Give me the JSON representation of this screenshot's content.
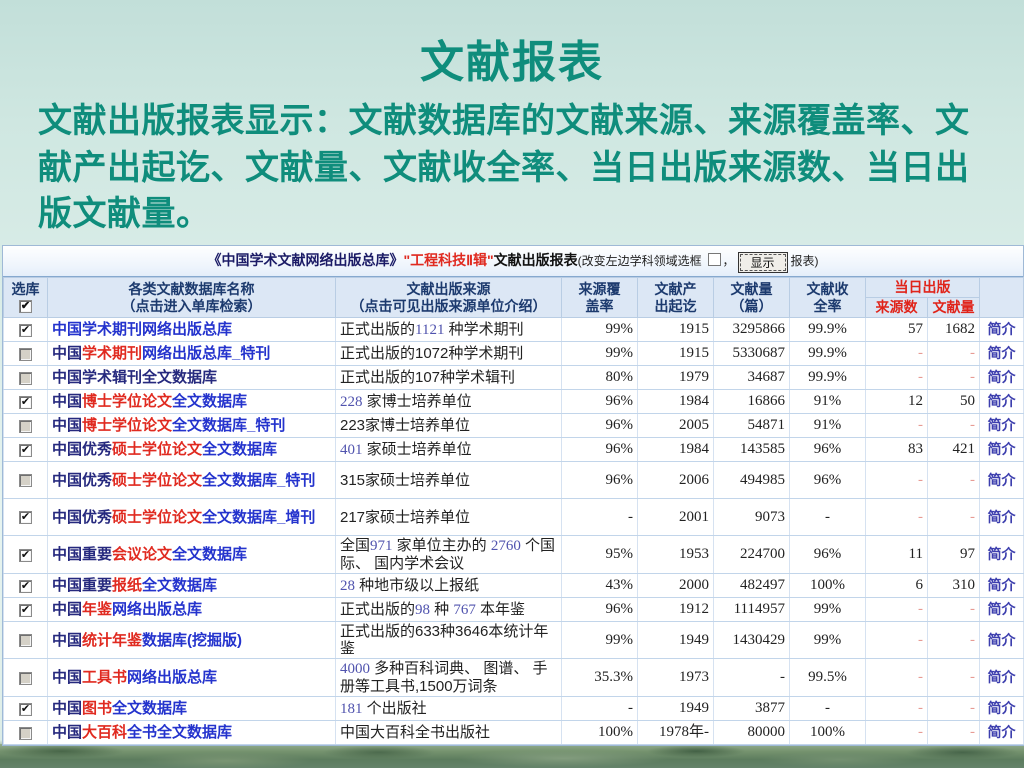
{
  "slide": {
    "title": "文献报表",
    "body": "文献出版报表显示：文献数据库的文献来源、来源覆盖率、文献产出起讫、文献量、文献收全率、当日出版来源数、当日出版文献量。"
  },
  "icons": {
    "check_glyph": "✔"
  },
  "colors": {
    "accent_teal": "#0f8d7c",
    "link_blue": "#2433cd",
    "link_navy": "#26297e",
    "highlight_red": "#e02a20",
    "number_blue": "#5053ae",
    "today_red": "#e0392b",
    "today_dash_red": "#e79b94",
    "intro_link_blue": "#3d3fae",
    "text_black": "#222222",
    "header_text_navy": "#1c3a6e",
    "header_bg": "#dce7f5"
  },
  "report": {
    "caption": {
      "library": "《中国学术文献网络出版总库》",
      "subject": "\"工程科技Ⅱ辑\"",
      "suffix": "文献出版报表",
      "note_prefix": "(改变左边学科领域选框",
      "note_comma": "，",
      "show_button": "显示",
      "note_suffix": "报表)"
    },
    "headers": {
      "select": "选库",
      "name_l1": "各类文献数据库名称",
      "name_l2": "（点击进入单库检索）",
      "source_l1": "文献出版来源",
      "source_l2": "（点击可见出版来源单位介绍）",
      "coverage_l1": "来源覆",
      "coverage_l2": "盖率",
      "span_l1": "文献产",
      "span_l2": "出起讫",
      "volume_l1": "文献量",
      "volume_l2": "（篇）",
      "complete_l1": "文献收",
      "complete_l2": "全率",
      "today": "当日出版",
      "today_source": "来源数",
      "today_volume": "文献量"
    },
    "intro_label": "简介",
    "rows": [
      {
        "checked": true,
        "name": [
          [
            "中国学术期刊网络出版总库",
            "blue"
          ]
        ],
        "source": [
          [
            "正式出版的",
            "black"
          ],
          [
            "1121",
            "num"
          ],
          [
            " 种学术期刊",
            "black"
          ]
        ],
        "coverage": "99%",
        "span": "1915",
        "volume": "3295866",
        "complete": "99.9%",
        "today_source": "57",
        "today_volume": "1682"
      },
      {
        "checked": false,
        "name": [
          [
            "中国",
            "navy"
          ],
          [
            "学术期刊",
            "red"
          ],
          [
            "网络出版总库_特刊",
            "blue"
          ]
        ],
        "source": [
          [
            "正式出版的1072种学术期刊",
            "black"
          ]
        ],
        "coverage": "99%",
        "span": "1915",
        "volume": "5330687",
        "complete": "99.9%",
        "today_source": "-",
        "today_volume": "-"
      },
      {
        "checked": false,
        "name": [
          [
            "中国学术辑刊全文数据库",
            "navy"
          ]
        ],
        "source": [
          [
            "正式出版的107种学术辑刊",
            "black"
          ]
        ],
        "coverage": "80%",
        "span": "1979",
        "volume": "34687",
        "complete": "99.9%",
        "today_source": "-",
        "today_volume": "-"
      },
      {
        "checked": true,
        "name": [
          [
            "中国",
            "navy"
          ],
          [
            "博士学位论文",
            "red"
          ],
          [
            "全文数据库",
            "blue"
          ]
        ],
        "source": [
          [
            "228",
            "num"
          ],
          [
            " 家博士培养单位",
            "black"
          ]
        ],
        "coverage": "96%",
        "span": "1984",
        "volume": "16866",
        "complete": "91%",
        "today_source": "12",
        "today_volume": "50"
      },
      {
        "checked": false,
        "name": [
          [
            "中国",
            "navy"
          ],
          [
            "博士学位论文",
            "red"
          ],
          [
            "全文数据库_特刊",
            "blue"
          ]
        ],
        "source": [
          [
            "223家博士培养单位",
            "black"
          ]
        ],
        "coverage": "96%",
        "span": "2005",
        "volume": "54871",
        "complete": "91%",
        "today_source": "-",
        "today_volume": "-"
      },
      {
        "checked": true,
        "name": [
          [
            "中国优秀",
            "navy"
          ],
          [
            "硕士学位论文",
            "red"
          ],
          [
            "全文数据库",
            "blue"
          ]
        ],
        "source": [
          [
            "401",
            "num"
          ],
          [
            " 家硕士培养单位",
            "black"
          ]
        ],
        "coverage": "96%",
        "span": "1984",
        "volume": "143585",
        "complete": "96%",
        "today_source": "83",
        "today_volume": "421"
      },
      {
        "checked": false,
        "name": [
          [
            "中国优秀",
            "navy"
          ],
          [
            "硕士学位论文",
            "red"
          ],
          [
            "全文数据库_特刊",
            "blue"
          ]
        ],
        "source": [
          [
            "315家硕士培养单位",
            "black"
          ]
        ],
        "coverage": "96%",
        "span": "2006",
        "volume": "494985",
        "complete": "96%",
        "today_source": "-",
        "today_volume": "-"
      },
      {
        "checked": true,
        "name": [
          [
            "中国优秀",
            "navy"
          ],
          [
            "硕士学位论文",
            "red"
          ],
          [
            "全文数据库_增刊",
            "blue"
          ]
        ],
        "source": [
          [
            "217家硕士培养单位",
            "black"
          ]
        ],
        "coverage": "-",
        "span": "2001",
        "volume": "9073",
        "complete": "-",
        "today_source": "-",
        "today_volume": "-"
      },
      {
        "checked": true,
        "name": [
          [
            "中国重要",
            "navy"
          ],
          [
            "会议论文",
            "red"
          ],
          [
            "全文数据库",
            "blue"
          ]
        ],
        "source": [
          [
            "全国",
            "black"
          ],
          [
            "971",
            "num"
          ],
          [
            " 家单位主办的 ",
            "black"
          ],
          [
            "2760",
            "num"
          ],
          [
            " 个国际、 国内学术会议",
            "black"
          ]
        ],
        "coverage": "95%",
        "span": "1953",
        "volume": "224700",
        "complete": "96%",
        "today_source": "11",
        "today_volume": "97"
      },
      {
        "checked": true,
        "name": [
          [
            "中国重要",
            "navy"
          ],
          [
            "报纸",
            "red"
          ],
          [
            "全文数据库",
            "blue"
          ]
        ],
        "source": [
          [
            "28",
            "num"
          ],
          [
            " 种地市级以上报纸",
            "black"
          ]
        ],
        "coverage": "43%",
        "span": "2000",
        "volume": "482497",
        "complete": "100%",
        "today_source": "6",
        "today_volume": "310"
      },
      {
        "checked": true,
        "name": [
          [
            "中国",
            "navy"
          ],
          [
            "年鉴",
            "red"
          ],
          [
            "网络出版总库",
            "blue"
          ]
        ],
        "source": [
          [
            "正式出版的",
            "black"
          ],
          [
            "98",
            "num"
          ],
          [
            " 种 ",
            "black"
          ],
          [
            "767",
            "num"
          ],
          [
            " 本年鉴",
            "black"
          ]
        ],
        "coverage": "96%",
        "span": "1912",
        "volume": "1114957",
        "complete": "99%",
        "today_source": "-",
        "today_volume": "-"
      },
      {
        "checked": false,
        "name": [
          [
            "中国",
            "navy"
          ],
          [
            "统计年鉴",
            "red"
          ],
          [
            "数据库(挖掘版)",
            "blue"
          ]
        ],
        "source": [
          [
            "正式出版的633种3646本统计年鉴",
            "black"
          ]
        ],
        "coverage": "99%",
        "span": "1949",
        "volume": "1430429",
        "complete": "99%",
        "today_source": "-",
        "today_volume": "-"
      },
      {
        "checked": false,
        "name": [
          [
            "中国",
            "navy"
          ],
          [
            "工具书",
            "red"
          ],
          [
            "网络出版总库",
            "blue"
          ]
        ],
        "source": [
          [
            "4000",
            "num"
          ],
          [
            " 多种百科词典、 图谱、 手册等工具书,1500万词条",
            "black"
          ]
        ],
        "coverage": "35.3%",
        "span": "1973",
        "volume": "-",
        "complete": "99.5%",
        "today_source": "-",
        "today_volume": "-"
      },
      {
        "checked": true,
        "name": [
          [
            "中国",
            "navy"
          ],
          [
            "图书",
            "red"
          ],
          [
            "全文数据库",
            "blue"
          ]
        ],
        "source": [
          [
            "181",
            "num"
          ],
          [
            " 个出版社",
            "black"
          ]
        ],
        "coverage": "-",
        "span": "1949",
        "volume": "3877",
        "complete": "-",
        "today_source": "-",
        "today_volume": "-"
      },
      {
        "checked": false,
        "name": [
          [
            "中国",
            "navy"
          ],
          [
            "大百科",
            "red"
          ],
          [
            "全书全文数据库",
            "blue"
          ]
        ],
        "source": [
          [
            "中国大百科全书出版社",
            "black"
          ]
        ],
        "coverage": "100%",
        "span": "1978年-",
        "volume": "80000",
        "complete": "100%",
        "today_source": "-",
        "today_volume": "-"
      }
    ]
  }
}
